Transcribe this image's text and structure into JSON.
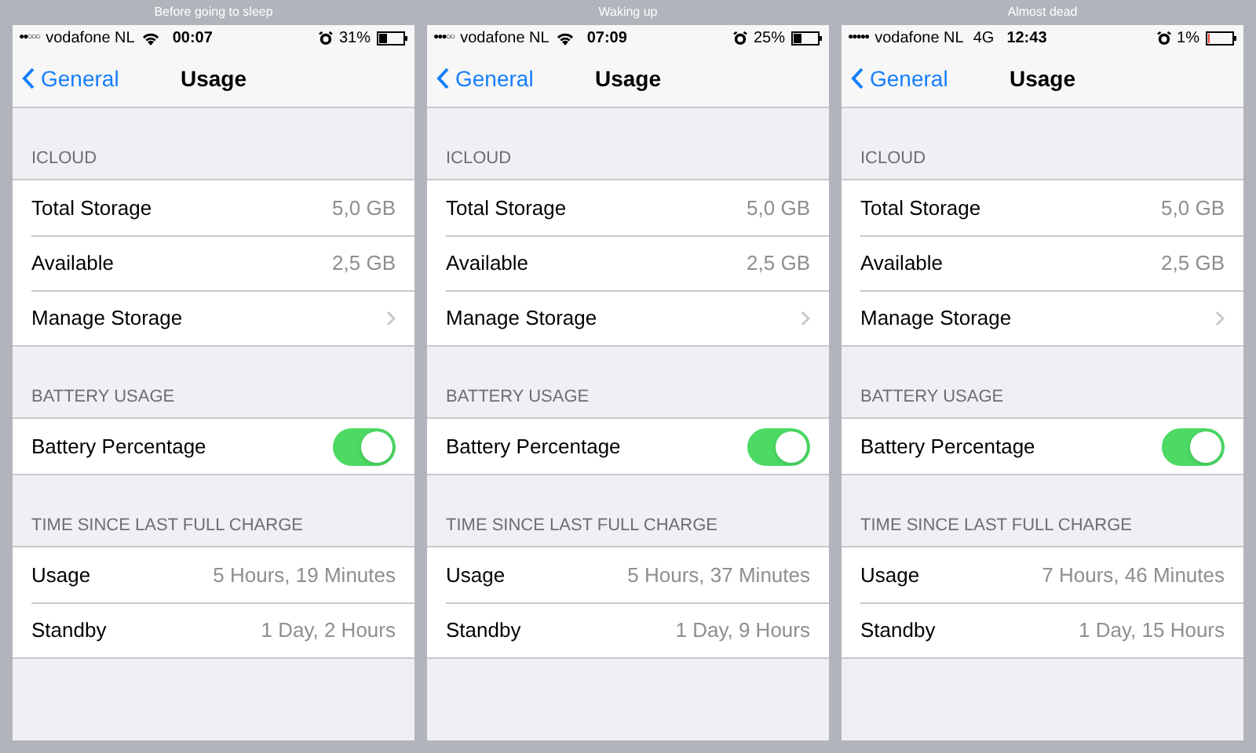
{
  "phones": [
    {
      "caption": "Before going to sleep",
      "status": {
        "signal": "●●○○○",
        "carrier": "vodafone NL",
        "network": {
          "kind": "wifi"
        },
        "time": "00:07",
        "battery": "31%",
        "battery_low": false
      },
      "nav": {
        "back": "General",
        "title": "Usage"
      },
      "sections": [
        {
          "header": "ICLOUD",
          "rows": [
            {
              "kind": "value",
              "label": "Total Storage",
              "value": "5,0 GB"
            },
            {
              "kind": "value",
              "label": "Available",
              "value": "2,5 GB"
            },
            {
              "kind": "link",
              "label": "Manage Storage"
            }
          ]
        },
        {
          "header": "BATTERY USAGE",
          "rows": [
            {
              "kind": "toggle",
              "label": "Battery Percentage",
              "on": true
            }
          ]
        },
        {
          "header": "TIME SINCE LAST FULL CHARGE",
          "rows": [
            {
              "kind": "value",
              "label": "Usage",
              "value": "5 Hours, 19 Minutes"
            },
            {
              "kind": "value",
              "label": "Standby",
              "value": "1 Day, 2 Hours"
            }
          ]
        }
      ]
    },
    {
      "caption": "Waking up",
      "status": {
        "signal": "●●●○○",
        "carrier": "vodafone NL",
        "network": {
          "kind": "wifi"
        },
        "time": "07:09",
        "battery": "25%",
        "battery_low": false
      },
      "nav": {
        "back": "General",
        "title": "Usage"
      },
      "sections": [
        {
          "header": "ICLOUD",
          "rows": [
            {
              "kind": "value",
              "label": "Total Storage",
              "value": "5,0 GB"
            },
            {
              "kind": "value",
              "label": "Available",
              "value": "2,5 GB"
            },
            {
              "kind": "link",
              "label": "Manage Storage"
            }
          ]
        },
        {
          "header": "BATTERY USAGE",
          "rows": [
            {
              "kind": "toggle",
              "label": "Battery Percentage",
              "on": true
            }
          ]
        },
        {
          "header": "TIME SINCE LAST FULL CHARGE",
          "rows": [
            {
              "kind": "value",
              "label": "Usage",
              "value": "5 Hours, 37 Minutes"
            },
            {
              "kind": "value",
              "label": "Standby",
              "value": "1 Day, 9 Hours"
            }
          ]
        }
      ]
    },
    {
      "caption": "Almost dead",
      "status": {
        "signal": "●●●●●",
        "carrier": "vodafone NL",
        "network": {
          "kind": "text",
          "text": "4G"
        },
        "time": "12:43",
        "battery": "1%",
        "battery_low": true
      },
      "nav": {
        "back": "General",
        "title": "Usage"
      },
      "sections": [
        {
          "header": "ICLOUD",
          "rows": [
            {
              "kind": "value",
              "label": "Total Storage",
              "value": "5,0 GB"
            },
            {
              "kind": "value",
              "label": "Available",
              "value": "2,5 GB"
            },
            {
              "kind": "link",
              "label": "Manage Storage"
            }
          ]
        },
        {
          "header": "BATTERY USAGE",
          "rows": [
            {
              "kind": "toggle",
              "label": "Battery Percentage",
              "on": true
            }
          ]
        },
        {
          "header": "TIME SINCE LAST FULL CHARGE",
          "rows": [
            {
              "kind": "value",
              "label": "Usage",
              "value": "7 Hours, 46 Minutes"
            },
            {
              "kind": "value",
              "label": "Standby",
              "value": "1 Day, 15 Hours"
            }
          ]
        }
      ]
    }
  ]
}
